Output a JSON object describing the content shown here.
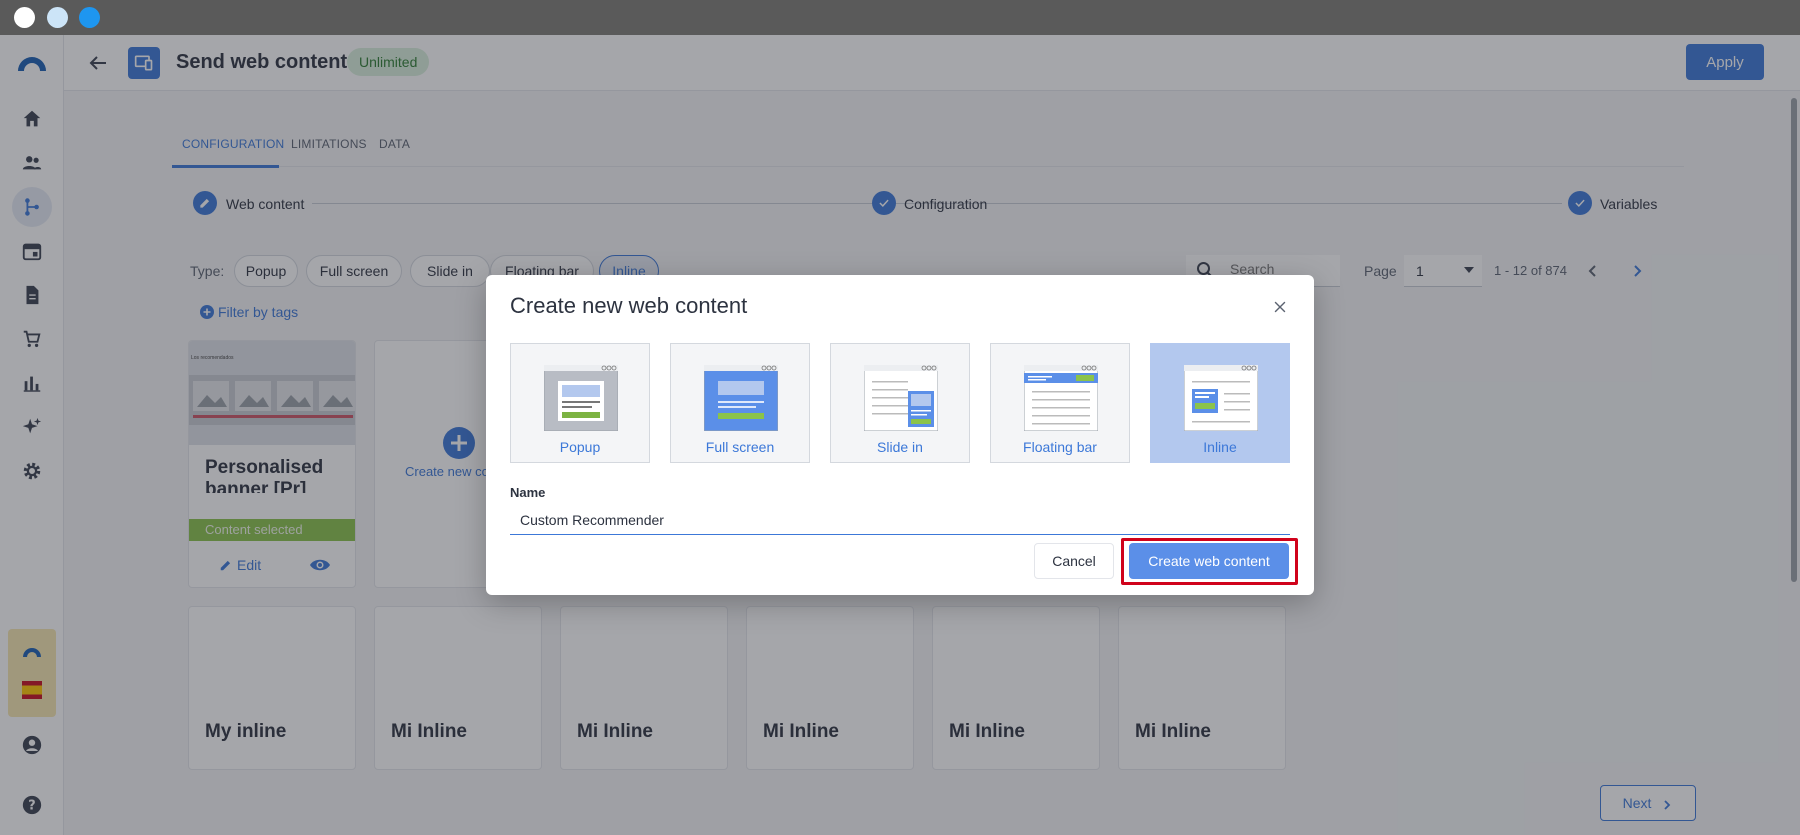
{
  "window": {
    "controls": [
      {
        "name": "close",
        "color": "#ffffff"
      },
      {
        "name": "minimize",
        "color": "#cce4f7"
      },
      {
        "name": "maximize",
        "color": "#1e96f0"
      }
    ]
  },
  "sidebar": {
    "items": [
      "logo-icon",
      "home-icon",
      "people-icon",
      "flow-icon",
      "calendar-icon",
      "document-icon",
      "cart-icon",
      "chart-icon",
      "sparkles-icon",
      "gear-icon",
      "brand-icon",
      "spain-flag-icon",
      "account-icon",
      "help-icon"
    ]
  },
  "header": {
    "title": "Send web content",
    "badge": "Unlimited",
    "apply_label": "Apply"
  },
  "tabs": [
    {
      "label": "CONFIGURATION",
      "active": true
    },
    {
      "label": "LIMITATIONS",
      "active": false
    },
    {
      "label": "DATA",
      "active": false
    }
  ],
  "stepper": {
    "steps": [
      {
        "label": "Web content",
        "state": "editing"
      },
      {
        "label": "Configuration",
        "state": "done"
      },
      {
        "label": "Variables",
        "state": "done"
      }
    ]
  },
  "filters": {
    "type_label": "Type:",
    "chips": [
      "Popup",
      "Full screen",
      "Slide in",
      "Floating bar",
      "Inline"
    ],
    "filter_tags_label": "Filter by tags",
    "search_placeholder": "Search",
    "page_label": "Page",
    "page_value": "1",
    "page_count": "1 - 12 of 874"
  },
  "cards": {
    "first": {
      "thumb_heading": "Los recomendados",
      "title_line1": "Personalised",
      "title_line2": "banner [Pr]",
      "status": "Content selected",
      "edit_label": "Edit"
    },
    "create_label": "Create new content",
    "bottom_titles": [
      "My inline",
      "Mi Inline",
      "Mi Inline",
      "Mi Inline",
      "Mi Inline",
      "Mi Inline"
    ]
  },
  "modal": {
    "title": "Create new web content",
    "types": [
      {
        "label": "Popup",
        "selected": false
      },
      {
        "label": "Full screen",
        "selected": false
      },
      {
        "label": "Slide in",
        "selected": false
      },
      {
        "label": "Floating bar",
        "selected": false
      },
      {
        "label": "Inline",
        "selected": true
      }
    ],
    "name_label": "Name",
    "name_value": "Custom Recommender",
    "cancel_label": "Cancel",
    "create_label": "Create web content"
  },
  "footer": {
    "next_label": "Next"
  },
  "colors": {
    "accent": "#3c78d8",
    "highlight": "#d0021b",
    "success_bg": "#d9f0dc",
    "success_text": "#2e7d32",
    "selected_tile": "#b3c8ee"
  }
}
